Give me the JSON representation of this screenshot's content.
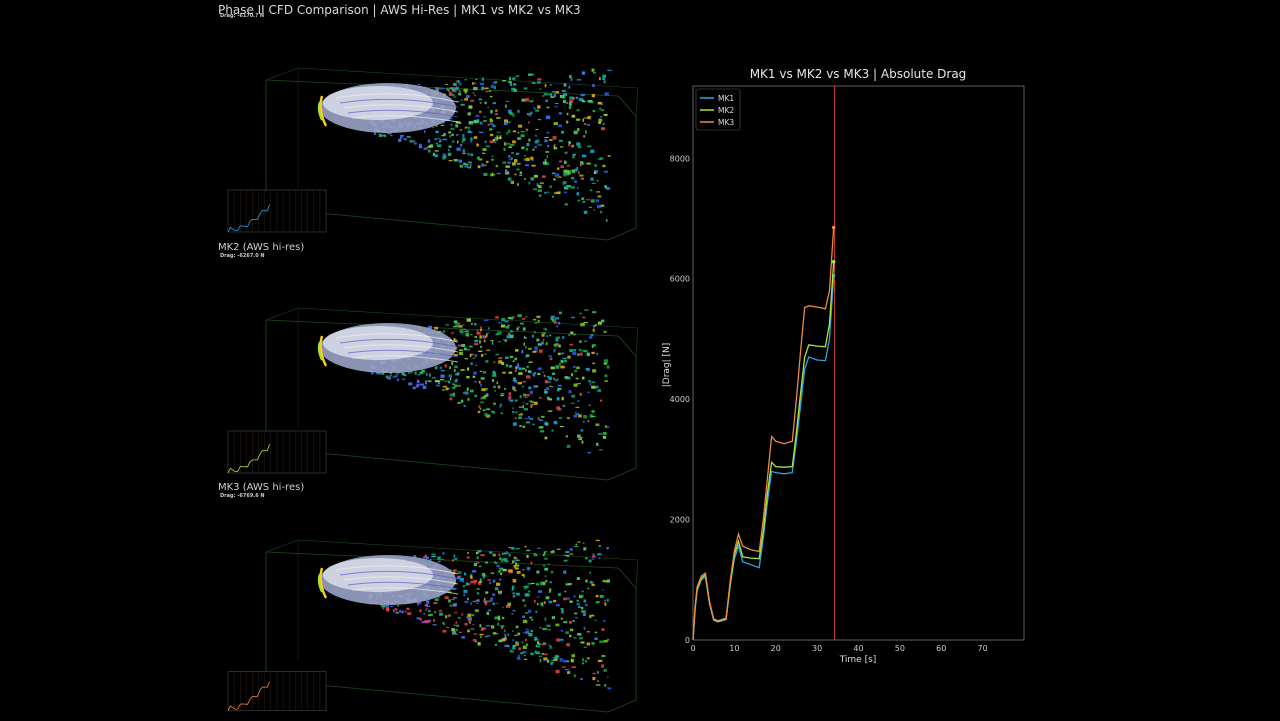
{
  "header": {
    "title": "Phase II CFD Comparison | AWS Hi-Res | MK1 vs MK2 vs MK3"
  },
  "panels": [
    {
      "id": "mk1",
      "drag_text": "Drag: -6170.? N"
    },
    {
      "id": "mk2",
      "label": "MK2 (AWS hi-res)",
      "drag_text": "Drag: -6267.0 N"
    },
    {
      "id": "mk3",
      "label": "MK3 (AWS hi-res)",
      "drag_text": "Drag: -6769.6 N"
    }
  ],
  "colors": {
    "MK1": "#2aa5e0",
    "MK2": "#a8e63a",
    "MK3": "#f08a3c",
    "cursor": "#c0392b"
  },
  "chart_data": {
    "type": "line",
    "title": "MK1 vs MK2 vs MK3 | Absolute Drag",
    "xlabel": "Time [s]",
    "ylabel": "|Drag| [N]",
    "xlim": [
      0,
      80
    ],
    "ylim": [
      0,
      9200
    ],
    "xticks": [
      0,
      10,
      20,
      30,
      40,
      50,
      60,
      70
    ],
    "yticks": [
      0,
      2000,
      4000,
      6000,
      8000
    ],
    "grid": true,
    "legend": "top-left",
    "cursor_x": 34.2,
    "series": [
      {
        "name": "MK1",
        "color": "#2aa5e0",
        "x": [
          0,
          0.5,
          1,
          2,
          3,
          4,
          5,
          6,
          7,
          8,
          9,
          10,
          11,
          12,
          14,
          16,
          17,
          18,
          19,
          20,
          22,
          24,
          25,
          26,
          27,
          28,
          30,
          32,
          33,
          34
        ],
        "y": [
          0,
          500,
          820,
          1000,
          1050,
          600,
          330,
          300,
          320,
          340,
          900,
          1350,
          1560,
          1300,
          1250,
          1200,
          1700,
          2300,
          2800,
          2780,
          2760,
          2780,
          3300,
          3900,
          4500,
          4700,
          4650,
          4640,
          5000,
          6050
        ]
      },
      {
        "name": "MK2",
        "color": "#a8e63a",
        "x": [
          0,
          0.5,
          1,
          2,
          3,
          4,
          5,
          6,
          7,
          8,
          9,
          10,
          11,
          12,
          14,
          16,
          17,
          18,
          19,
          20,
          22,
          24,
          25,
          26,
          27,
          28,
          30,
          32,
          33,
          34
        ],
        "y": [
          0,
          520,
          850,
          1030,
          1080,
          620,
          340,
          310,
          330,
          350,
          940,
          1420,
          1640,
          1380,
          1360,
          1350,
          1800,
          2450,
          2950,
          2880,
          2870,
          2880,
          3450,
          4100,
          4700,
          4900,
          4880,
          4870,
          5250,
          6280
        ]
      },
      {
        "name": "MK3",
        "color": "#f08a3c",
        "x": [
          0,
          0.5,
          1,
          2,
          3,
          4,
          5,
          6,
          7,
          8,
          9,
          10,
          11,
          12,
          14,
          16,
          17,
          18,
          19,
          20,
          22,
          24,
          25,
          26,
          27,
          28,
          30,
          32,
          33,
          34
        ],
        "y": [
          0,
          550,
          880,
          1060,
          1110,
          640,
          350,
          320,
          340,
          360,
          980,
          1480,
          1760,
          1560,
          1500,
          1470,
          2000,
          2700,
          3380,
          3300,
          3260,
          3300,
          4000,
          4800,
          5520,
          5550,
          5530,
          5500,
          5800,
          6850
        ]
      }
    ]
  },
  "mini_chart_data": [
    {
      "type": "line",
      "series": [
        {
          "name": "MK1",
          "color": "#2aa5e0",
          "x": [
            0,
            2,
            4,
            6,
            8,
            10,
            12,
            14,
            16,
            18,
            20,
            22,
            24,
            26,
            28,
            30,
            32,
            34
          ],
          "y": [
            0,
            1000,
            600,
            300,
            340,
            1350,
            1300,
            1250,
            1200,
            2300,
            2780,
            2760,
            2780,
            3900,
            4700,
            4650,
            4640,
            6050
          ]
        }
      ]
    },
    {
      "type": "line",
      "series": [
        {
          "name": "MK2",
          "color": "#a8e63a",
          "x": [
            0,
            2,
            4,
            6,
            8,
            10,
            12,
            14,
            16,
            18,
            20,
            22,
            24,
            26,
            28,
            30,
            32,
            34
          ],
          "y": [
            0,
            1030,
            620,
            310,
            350,
            1420,
            1380,
            1360,
            1350,
            2450,
            2880,
            2870,
            2880,
            4100,
            4900,
            4880,
            4870,
            6280
          ]
        }
      ]
    },
    {
      "type": "line",
      "series": [
        {
          "name": "MK3",
          "color": "#f08a3c",
          "x": [
            0,
            2,
            4,
            6,
            8,
            10,
            12,
            14,
            16,
            18,
            20,
            22,
            24,
            26,
            28,
            30,
            32,
            34
          ],
          "y": [
            0,
            1060,
            640,
            320,
            360,
            1480,
            1560,
            1500,
            1470,
            2700,
            3300,
            3260,
            3300,
            4800,
            5550,
            5530,
            5500,
            6850
          ]
        }
      ]
    }
  ]
}
